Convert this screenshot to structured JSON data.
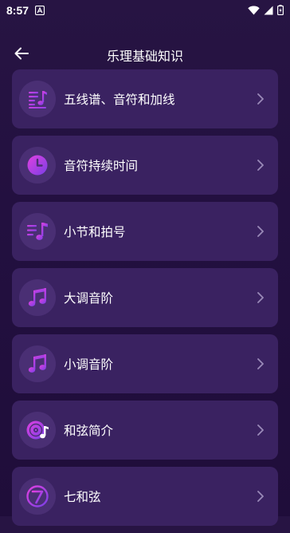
{
  "status_bar": {
    "time": "8:57"
  },
  "header": {
    "title": "乐理基础知识"
  },
  "items": [
    {
      "label": "五线谱、音符和加线",
      "icon": "staff-icon"
    },
    {
      "label": "音符持续时间",
      "icon": "clock-icon"
    },
    {
      "label": "小节和拍号",
      "icon": "music-list-icon"
    },
    {
      "label": "大调音阶",
      "icon": "music-note-icon"
    },
    {
      "label": "小调音阶",
      "icon": "music-note-icon"
    },
    {
      "label": "和弦简介",
      "icon": "disc-note-icon"
    },
    {
      "label": "七和弦",
      "icon": "seven-icon"
    }
  ],
  "colors": {
    "background": "#241140",
    "card": "#3a2261",
    "icon_circle": "#4a2f74",
    "accent_magenta": "#c63bdc",
    "accent_purple": "#7b3fe0"
  }
}
